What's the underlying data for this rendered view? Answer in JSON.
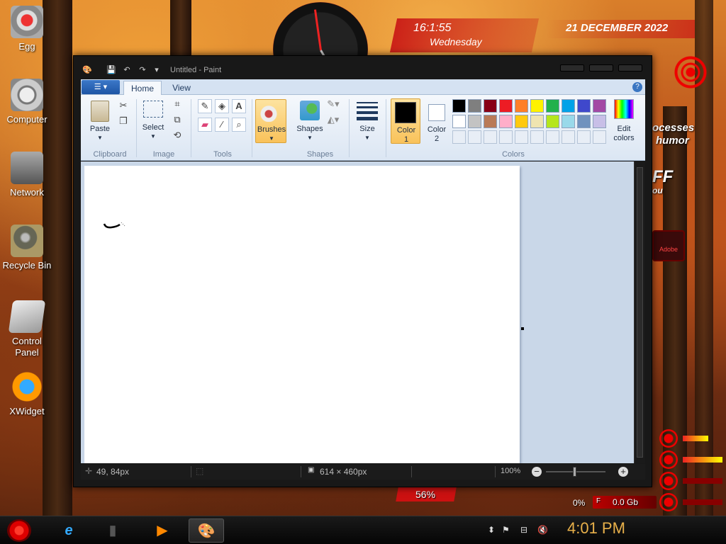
{
  "desktop": {
    "icons": [
      {
        "label": "Egg",
        "icon": "egg-icon"
      },
      {
        "label": "Computer",
        "icon": "computer-icon"
      },
      {
        "label": "Network",
        "icon": "network-icon"
      },
      {
        "label": "Recycle Bin",
        "icon": "recycle-bin-icon"
      },
      {
        "label": "Control Panel",
        "icon": "control-panel-icon"
      },
      {
        "label": "XWidget",
        "icon": "xwidget-icon"
      }
    ]
  },
  "widgets": {
    "time": "16:1:55",
    "weekday": "Wednesday",
    "date": "21 DECEMBER 2022",
    "side_text_1": "ocesses",
    "side_text_2": "humor",
    "side_text_3": "FF",
    "side_text_4": "ou",
    "percent": "56%",
    "cpu_pct": "0%",
    "disk_letter": "F",
    "disk_value": "0.0 Gb",
    "red_label": "Adobe"
  },
  "window": {
    "title": "Untitled - Paint",
    "tabs": [
      {
        "label": "Home",
        "active": true
      },
      {
        "label": "View",
        "active": false
      }
    ],
    "ribbon": {
      "clipboard": {
        "paste": "Paste",
        "group": "Clipboard"
      },
      "image": {
        "select": "Select",
        "group": "Image"
      },
      "tools": {
        "group": "Tools"
      },
      "brushes": "Brushes",
      "shapes": {
        "label": "Shapes",
        "group": "Shapes"
      },
      "size": "Size",
      "color1": {
        "line1": "Color",
        "line2": "1"
      },
      "color2": {
        "line1": "Color",
        "line2": "2"
      },
      "colors_group": "Colors",
      "edit_colors": {
        "line1": "Edit",
        "line2": "colors"
      },
      "palette_row1": [
        "#000000",
        "#7f7f7f",
        "#880015",
        "#ed1c24",
        "#ff7f27",
        "#fff200",
        "#22b14c",
        "#00a2e8",
        "#3f48cc",
        "#a349a4"
      ],
      "palette_row2": [
        "#ffffff",
        "#c3c3c3",
        "#b97a57",
        "#ffaec9",
        "#ffc90e",
        "#efe4b0",
        "#b5e61d",
        "#99d9ea",
        "#7092be",
        "#c8bfe7"
      ],
      "palette_empty_count": 10
    },
    "status": {
      "cursor_pos": "49, 84px",
      "canvas_size": "614 × 460px",
      "zoom": "100%"
    }
  },
  "taskbar": {
    "clock": "4:01 PM",
    "apps": [
      "internet-explorer-icon",
      "file-icon",
      "media-player-icon",
      "paint-icon"
    ]
  }
}
